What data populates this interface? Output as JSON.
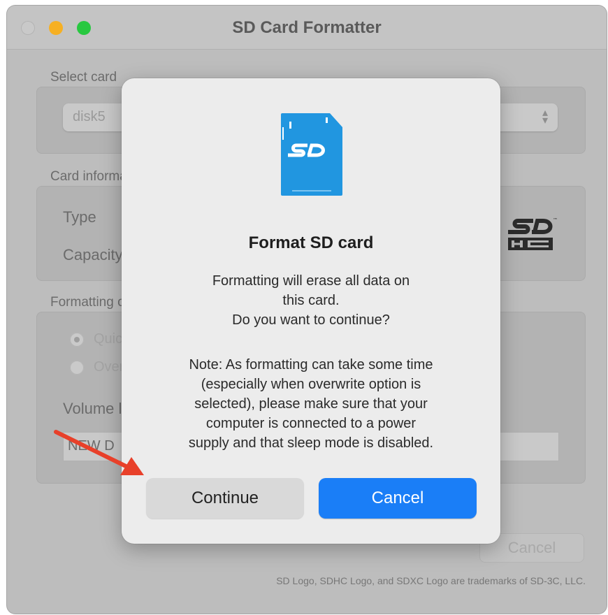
{
  "window": {
    "title": "SD Card Formatter"
  },
  "select_card": {
    "label": "Select card",
    "value": "disk5"
  },
  "card_info": {
    "label": "Card information",
    "type_label": "Type",
    "capacity_label": "Capacity"
  },
  "formatting": {
    "label": "Formatting options",
    "options": [
      "Quick format",
      "Overwrite format"
    ],
    "selected": 0,
    "volume_label": "Volume label",
    "volume_value": "NEW D"
  },
  "background_cancel": "Cancel",
  "footer": "SD Logo, SDHC Logo, and SDXC Logo are trademarks of SD-3C, LLC.",
  "dialog": {
    "title": "Format SD card",
    "message_lines": [
      "Formatting will erase all data on",
      "this card.",
      "Do you want to continue?"
    ],
    "note_lines": [
      "Note: As formatting can take some time",
      "(especially when overwrite option is",
      "selected), please make sure that your",
      "computer is connected to a power",
      "supply and that sleep mode is disabled."
    ],
    "continue_label": "Continue",
    "cancel_label": "Cancel"
  },
  "colors": {
    "accent": "#1a7ef7",
    "sd_icon": "#2196e0",
    "arrow": "#e8402a"
  }
}
